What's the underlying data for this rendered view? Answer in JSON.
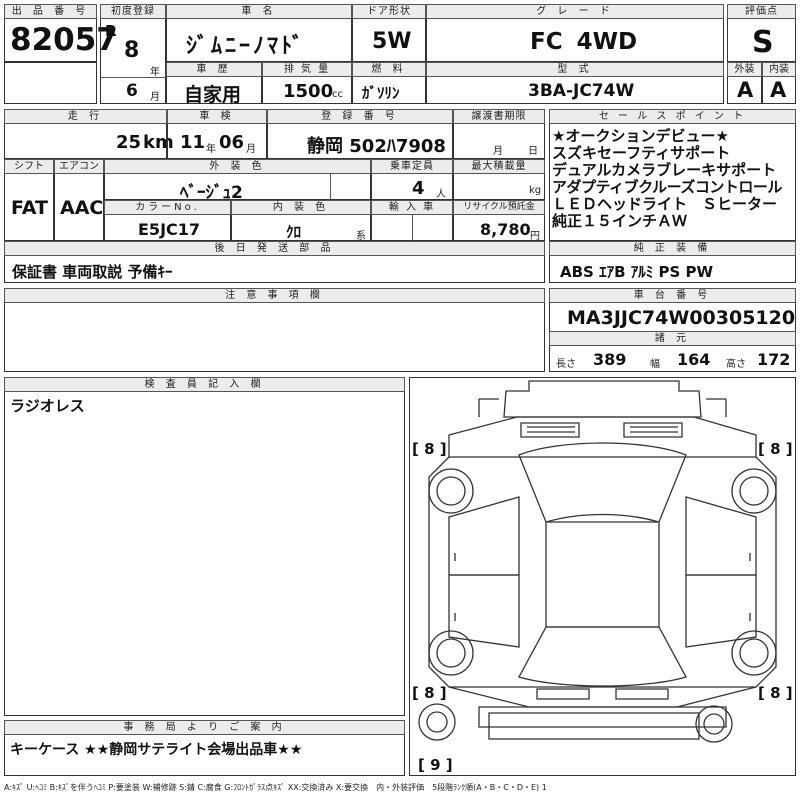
{
  "header": {
    "lot_no": {
      "label": "出 品 番 号",
      "value": "82057"
    },
    "first_reg": {
      "label": "初度登録",
      "era": "R",
      "year": "8",
      "year_unit": "年",
      "month": "6",
      "month_unit": "月"
    },
    "car_name": {
      "label": "車 名",
      "value": "ｼﾞﾑﾆｰﾉﾏﾄﾞ"
    },
    "door": {
      "label": "ドア形状",
      "value": "5W"
    },
    "grade": {
      "label": "グ レ ー ド",
      "value": "FC 4WD"
    },
    "score": {
      "label": "評価点",
      "value": "S"
    },
    "history": {
      "label": "車 歴",
      "value": "自家用"
    },
    "displacement": {
      "label": "排 気 量",
      "value": "1500",
      "unit": "cc"
    },
    "fuel": {
      "label": "燃 料",
      "value": "ｶﾞｿﾘﾝ"
    },
    "model_code": {
      "label": "型 式",
      "value": "3BA-JC74W"
    },
    "exterior": {
      "label": "外装",
      "value": "A"
    },
    "interior": {
      "label": "内装",
      "value": "A"
    }
  },
  "row2": {
    "mileage": {
      "label": "走 行",
      "value": "25",
      "unit": "km"
    },
    "inspection": {
      "label": "車 検",
      "year": "11",
      "year_unit": "年",
      "month": "06",
      "month_unit": "月"
    },
    "plate": {
      "label": "登 録 番 号",
      "value": "静岡 502ﾊ7908"
    },
    "transfer": {
      "label": "譲渡書期限",
      "month_unit": "月",
      "day_unit": "日"
    },
    "shift": {
      "label": "シフト",
      "value": "FAT"
    },
    "aircon": {
      "label": "エアコン",
      "value": "AAC"
    },
    "ext_color": {
      "label": "外 装 色",
      "value": "ﾍﾞｰｼﾞｭ2"
    },
    "capacity": {
      "label": "乗車定員",
      "value": "4",
      "unit": "人"
    },
    "max_load": {
      "label": "最大積載量",
      "unit": "kg"
    },
    "color_no": {
      "label": "カラーNo.",
      "value": "E5JC17"
    },
    "int_color": {
      "label": "内 装 色",
      "value": "ｸﾛ",
      "unit": "系"
    },
    "import": {
      "label": "輸 入 車"
    },
    "recycle": {
      "label": "リサイクル預託金",
      "value": "8,780",
      "unit": "円"
    }
  },
  "sales_points": {
    "label": "セ ー ル ス ポ イ ン ト",
    "lines": [
      "★オークションデビュー★",
      "スズキセーフティサポート",
      "デュアルカメラブレーキサポート",
      "アダプティブクルーズコントロール",
      "ＬＥＤヘッドライト　Ｓヒーター",
      "純正１５インチＡＷ"
    ]
  },
  "equipment": {
    "label": "純 正 装 備",
    "value": "ABS ｴｱB ｱﾙﾐ PS PW"
  },
  "accessories": {
    "label": "後 日 発 送 部 品",
    "value": "保証書 車両取説 予備ｷｰ"
  },
  "notes": {
    "label": "注 意 事 項 欄"
  },
  "chassis": {
    "label": "車 台 番 号",
    "value": "MA3JJC74W00305120"
  },
  "specs": {
    "label": "諸 元",
    "length_label": "長さ",
    "length": "389",
    "width_label": "幅",
    "width": "164",
    "height_label": "高さ",
    "height": "172"
  },
  "inspector": {
    "label": "検 査 員 記 入 欄",
    "value": "ラジオレス"
  },
  "diagram": {
    "tl": "[ 8 ]",
    "tr": "[ 8 ]",
    "bl": "[ 8 ]",
    "br": "[ 8 ]",
    "spare": "[ 9 ]"
  },
  "office": {
    "label": "事 務 局 よ り ご 案 内",
    "value": "キーケース ★★静岡サテライト会場出品車★★"
  },
  "legend": "A:ｷｽﾞ U:ﾍｺﾐ B:ｷｽﾞを伴うﾍｺﾐ P:要塗装 W:補修跡 S:錆 C:腐食 G:ﾌﾛﾝﾄｶﾞﾗｽ点ｷｽﾞ XX:交換済み X:要交換　内・外装評価　5段階ﾗﾝｸ順(A・B・C・D・E) 1"
}
